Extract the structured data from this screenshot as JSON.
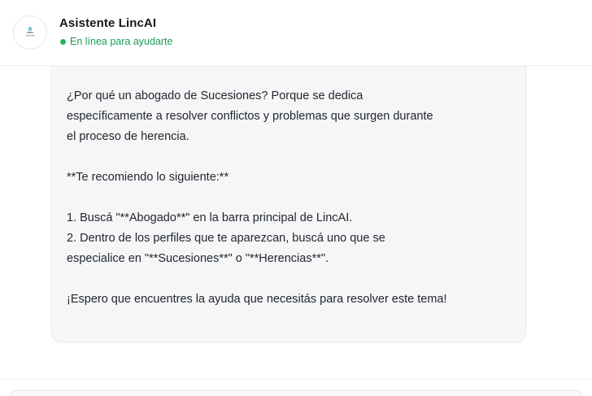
{
  "header": {
    "title": "Asistente LincAI",
    "status": "En línea para ayudarte",
    "status_color": "#22b463"
  },
  "message": {
    "paragraphs": [
      [
        "¿Por qué un abogado de Sucesiones? Porque se dedica",
        "específicamente a resolver conflictos y problemas que surgen durante",
        "el proceso de herencia."
      ],
      [
        "**Te recomiendo lo siguiente:**"
      ],
      [
        "1.  Buscá \"**Abogado**\" en la barra principal de LincAI.",
        "2.  Dentro de los perfiles que te aparezcan, buscá uno que se",
        "especialice en \"**Sucesiones**\" o \"**Herencias**\"."
      ],
      [
        "¡Espero que encuentres la ayuda que necesitás para resolver este tema!"
      ]
    ]
  },
  "icons": {
    "avatar": "lincai-logo-icon",
    "status": "online-dot-icon"
  }
}
